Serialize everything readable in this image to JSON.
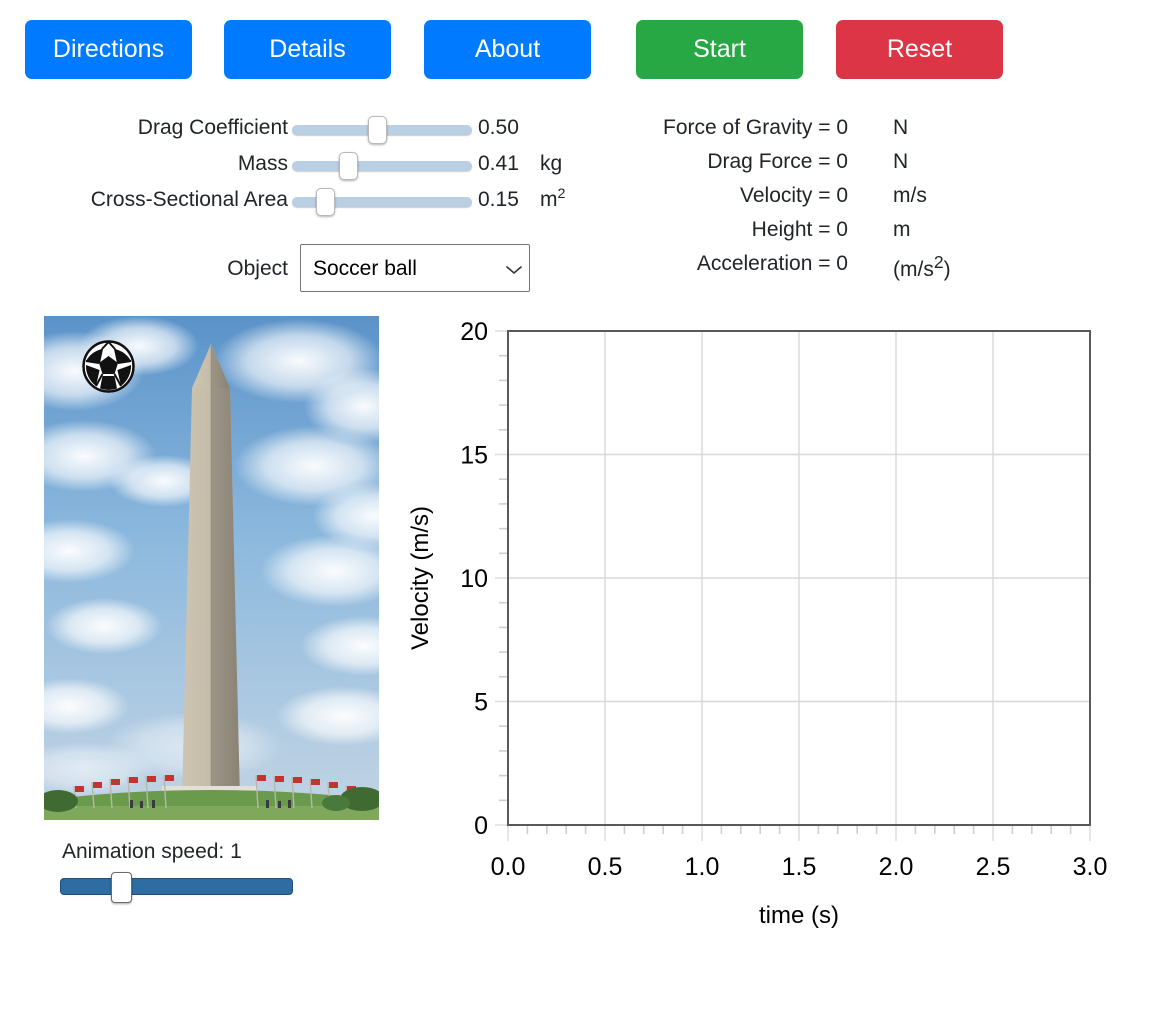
{
  "toolbar": {
    "buttons": [
      {
        "id": "directions",
        "label": "Directions",
        "color": "#007bff"
      },
      {
        "id": "details",
        "label": "Details",
        "color": "#007bff"
      },
      {
        "id": "about",
        "label": "About",
        "color": "#007bff"
      },
      {
        "id": "start",
        "label": "Start",
        "color": "#28a745"
      },
      {
        "id": "reset",
        "label": "Reset",
        "color": "#dc3545"
      }
    ]
  },
  "controls": {
    "sliders": [
      {
        "label": "Drag Coefficient",
        "value": "0.50",
        "unit": "",
        "fraction": 0.47
      },
      {
        "label": "Mass",
        "value": "0.41",
        "unit": "kg",
        "fraction": 0.29
      },
      {
        "label": "Cross-Sectional Area",
        "value": "0.15",
        "unit": "m2",
        "fraction": 0.15
      }
    ],
    "object": {
      "label": "Object",
      "selected": "Soccer ball",
      "options": [
        "Soccer ball"
      ]
    }
  },
  "readouts": [
    {
      "label": "Force of Gravity = 0",
      "unit": "N"
    },
    {
      "label": "Drag Force = 0",
      "unit": "N"
    },
    {
      "label": "Velocity = 0",
      "unit": "m/s"
    },
    {
      "label": "Height = 0",
      "unit": "m"
    },
    {
      "label": "Acceleration = 0",
      "unit": "(m/s2)"
    }
  ],
  "animation": {
    "scene_name": "washington-monument-photo",
    "object_icon": "soccer-ball-icon",
    "speed_label": "Animation speed: 1",
    "speed_value": 1,
    "speed_fraction": 0.24
  },
  "chart_data": {
    "type": "line",
    "title": "",
    "xlabel": "time (s)",
    "ylabel": "Velocity (m/s)",
    "xlim": [
      0,
      3
    ],
    "ylim": [
      0,
      20
    ],
    "xticks": [
      0,
      0.5,
      1,
      1.5,
      2,
      2.5,
      3
    ],
    "xticklabels": [
      "0.0",
      "0.5",
      "1.0",
      "1.5",
      "2.0",
      "2.5",
      "3.0"
    ],
    "yticks": [
      0,
      5,
      10,
      15,
      20
    ],
    "yticklabels": [
      "0",
      "5",
      "10",
      "15",
      "20"
    ],
    "x_minor_step": 0.1,
    "y_minor_step": 1,
    "grid": true,
    "legend": null,
    "series": [
      {
        "name": "Velocity",
        "x": [],
        "y": []
      }
    ]
  }
}
